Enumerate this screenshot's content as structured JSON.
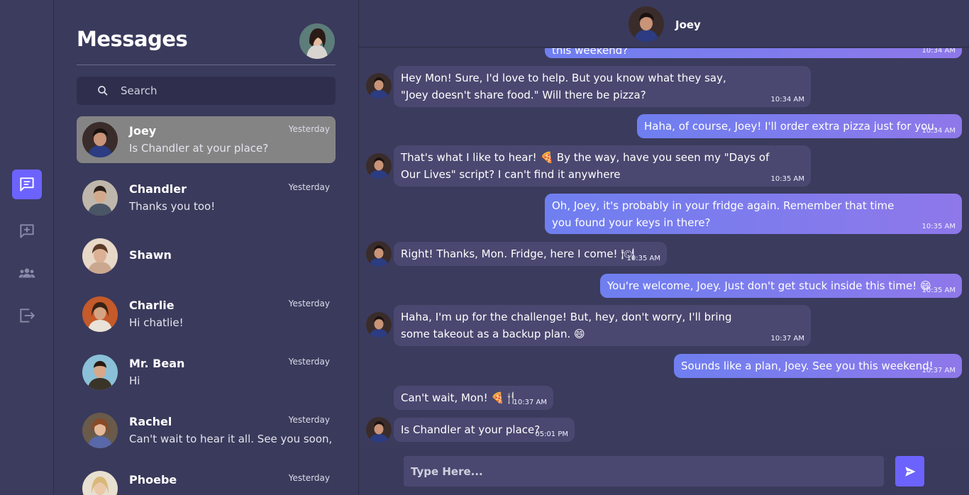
{
  "nav": {
    "items": [
      {
        "icon": "chat-bubble-icon",
        "active": true
      },
      {
        "icon": "new-chat-icon",
        "active": false
      },
      {
        "icon": "group-icon",
        "active": false
      },
      {
        "icon": "logout-icon",
        "active": false
      }
    ]
  },
  "panel": {
    "title": "Messages",
    "search_placeholder": "Search",
    "conversations": [
      {
        "name": "Joey",
        "time": "Yesterday",
        "preview": "Is Chandler at your place?",
        "active": true
      },
      {
        "name": "Chandler",
        "time": "Yesterday",
        "preview": "Thanks you too!"
      },
      {
        "name": "Shawn",
        "time": "",
        "preview": ""
      },
      {
        "name": "Charlie",
        "time": "Yesterday",
        "preview": "Hi chatlie!"
      },
      {
        "name": "Mr. Bean",
        "time": "Yesterday",
        "preview": "Hi"
      },
      {
        "name": "Rachel",
        "time": "Yesterday",
        "preview": "Can't wait to hear it all. See you soon, ..."
      },
      {
        "name": "Phoebe",
        "time": "Yesterday",
        "preview": ""
      }
    ]
  },
  "chat": {
    "contact_name": "Joey",
    "messages": [
      {
        "dir": "out",
        "text": "this weekend?",
        "time": "10:34 AM"
      },
      {
        "dir": "in",
        "text": "Hey Mon! Sure, I'd love to help. But you know what they say, \"Joey doesn't share food.\" Will there be pizza?",
        "time": "10:34 AM"
      },
      {
        "dir": "out",
        "text": "Haha, of course, Joey! I'll order extra pizza just for you.",
        "time": "10:34 AM"
      },
      {
        "dir": "in",
        "text": "That's what I like to hear! 🍕 By the way, have you seen my \"Days of Our Lives\" script? I can't find it anywhere",
        "time": "10:35 AM"
      },
      {
        "dir": "out",
        "text": "Oh, Joey, it's probably in your fridge again. Remember that time you found your keys in there?",
        "time": "10:35 AM"
      },
      {
        "dir": "in",
        "text": "Right! Thanks, Mon. Fridge, here I come! 🍽",
        "time": "10:35 AM"
      },
      {
        "dir": "out",
        "text": "You're welcome, Joey. Just don't get stuck inside this time! 😄",
        "time": "10:35 AM"
      },
      {
        "dir": "in",
        "text": "Haha, I'm up for the challenge! But, hey, don't worry, I'll bring some takeout as a backup plan. 😄",
        "time": "10:37 AM"
      },
      {
        "dir": "out",
        "text": "Sounds like a plan, Joey. See you this weekend!",
        "time": "10:37 AM"
      },
      {
        "dir": "in",
        "text": "Can't wait, Mon! 🍕🍴",
        "time": "10:37 AM"
      },
      {
        "dir": "in",
        "text": "Is Chandler at your place?",
        "time": "05:01 PM"
      }
    ]
  },
  "composer": {
    "placeholder": "Type Here..."
  },
  "colors": {
    "accent": "#6c63ff",
    "incoming_bubble": "#4a4870",
    "outgoing_start": "#6f7ff0",
    "outgoing_end": "#8e78ea",
    "active_conversation": "#848484"
  }
}
